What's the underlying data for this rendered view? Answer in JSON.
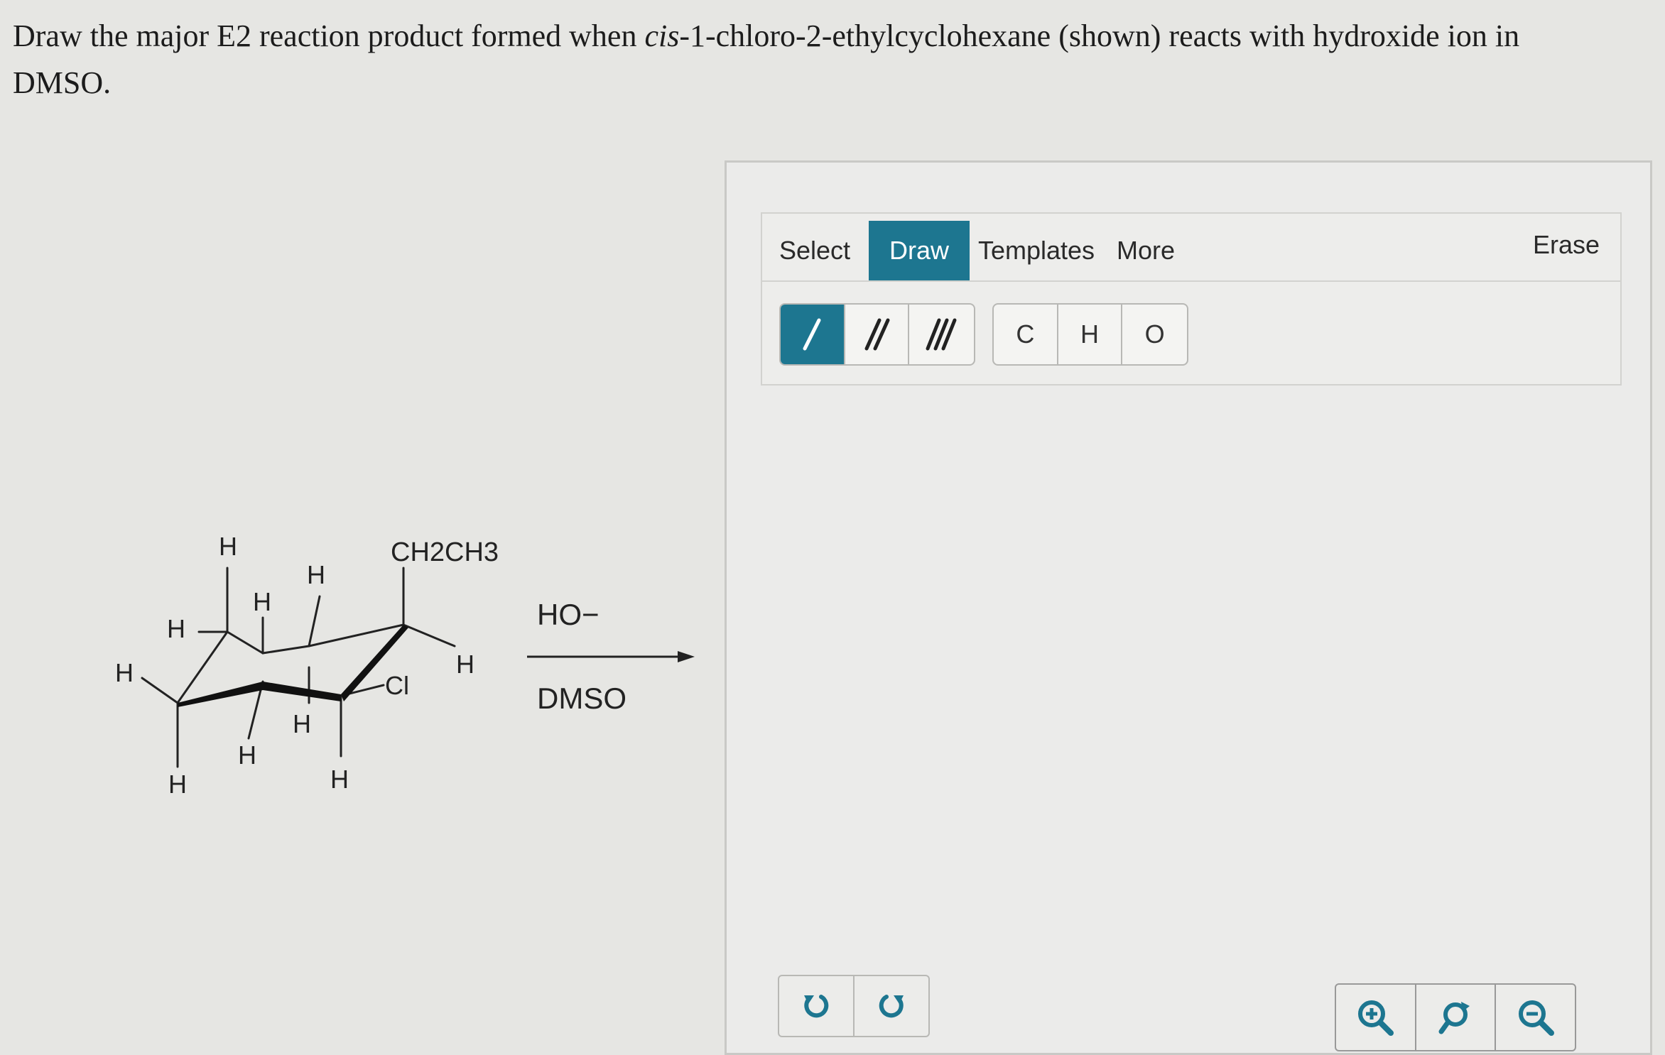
{
  "question": {
    "part1": "Draw the major E2 reaction product formed when ",
    "compound": "cis",
    "part2": "-1-chloro-2-ethylcyclohexane (shown) reacts with hydroxide ion in DMSO."
  },
  "molecule": {
    "ethyl_label": "CH2CH3",
    "chloro_label": "Cl",
    "hydrogen_label": "H"
  },
  "reaction": {
    "reagent": "HO−",
    "solvent": "DMSO"
  },
  "editor": {
    "tabs": {
      "select": "Select",
      "draw": "Draw",
      "templates": "Templates",
      "more": "More"
    },
    "erase": "Erase",
    "active_tab": "Draw",
    "bond_tools": [
      "single-bond",
      "double-bond",
      "triple-bond"
    ],
    "atoms": [
      "C",
      "H",
      "O"
    ],
    "accent_color": "#1d7690"
  },
  "controls": {
    "undo_icon": "undo-icon",
    "redo_icon": "redo-icon",
    "zoom_icons": [
      "zoom-in-icon",
      "reset-view-icon",
      "zoom-out-icon"
    ]
  }
}
